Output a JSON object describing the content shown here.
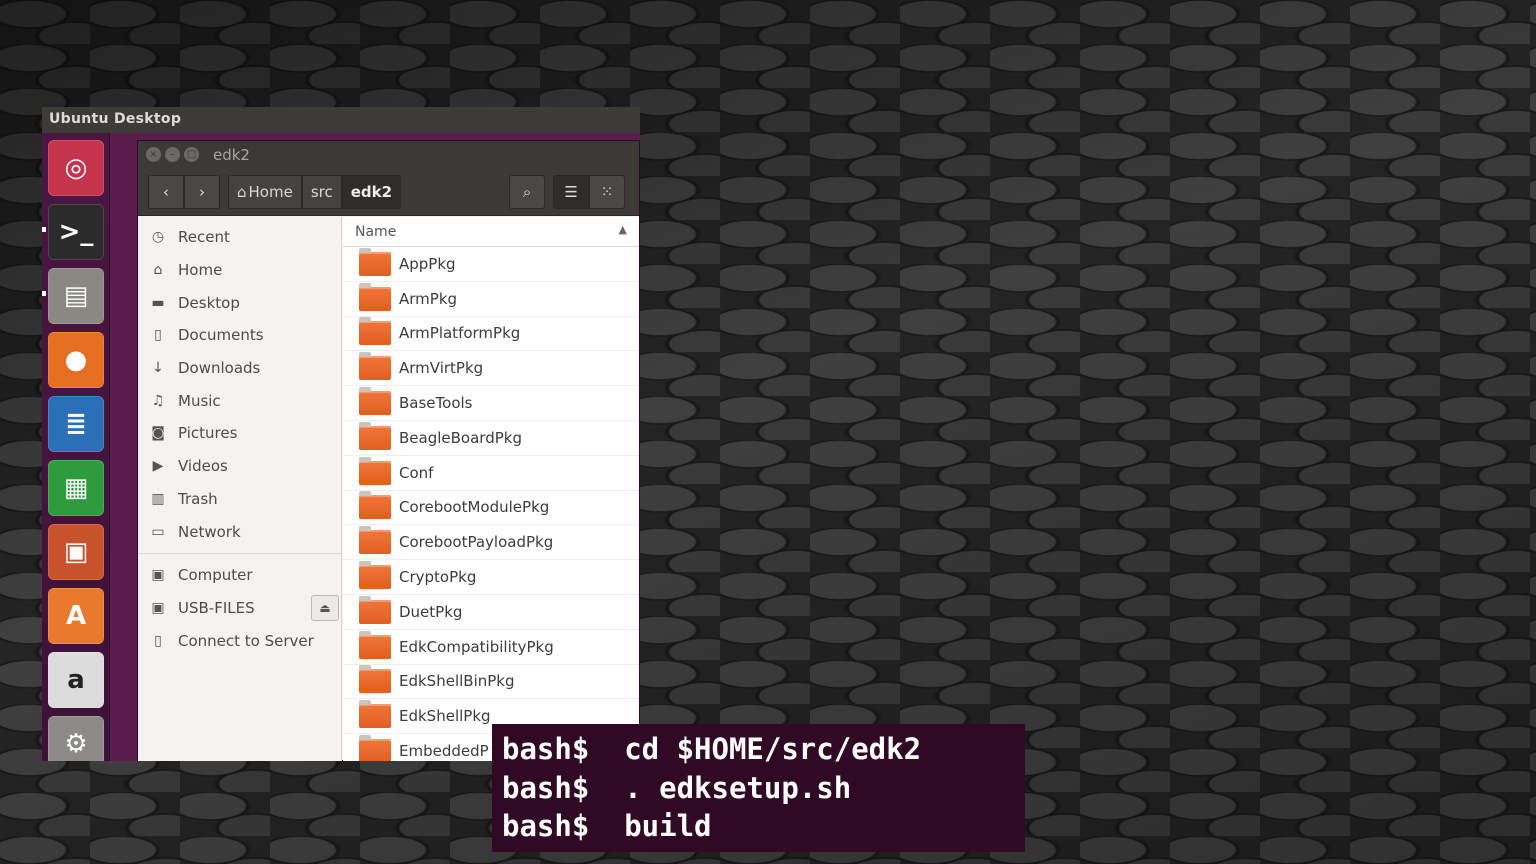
{
  "desktop": {
    "title": "Ubuntu Desktop"
  },
  "launcher": [
    {
      "icon": "ubuntu-dash-icon",
      "glyph": "◎",
      "bg": "#c5344c"
    },
    {
      "icon": "terminal-icon",
      "glyph": ">_",
      "bg": "#2b2b2b"
    },
    {
      "icon": "files-icon",
      "glyph": "▤",
      "bg": "#8a8882"
    },
    {
      "icon": "firefox-icon",
      "glyph": "●",
      "bg": "#e66e20"
    },
    {
      "icon": "writer-icon",
      "glyph": "≣",
      "bg": "#2a6fb8"
    },
    {
      "icon": "calc-icon",
      "glyph": "▦",
      "bg": "#2f9a3e"
    },
    {
      "icon": "impress-icon",
      "glyph": "▣",
      "bg": "#c8522c"
    },
    {
      "icon": "software-center-icon",
      "glyph": "A",
      "bg": "#e87a2e"
    },
    {
      "icon": "amazon-icon",
      "glyph": "a",
      "bg": "#dcdcdc"
    },
    {
      "icon": "system-settings-icon",
      "glyph": "⚙",
      "bg": "#8c8a86"
    }
  ],
  "window": {
    "title": "edk2",
    "breadcrumbs": [
      "Home",
      "src",
      "edk2"
    ]
  },
  "sidebar": {
    "places": [
      {
        "label": "Recent",
        "icon": "clock-icon",
        "glyph": "◷"
      },
      {
        "label": "Home",
        "icon": "home-icon",
        "glyph": "⌂"
      },
      {
        "label": "Desktop",
        "icon": "folder-icon",
        "glyph": "▬"
      },
      {
        "label": "Documents",
        "icon": "document-icon",
        "glyph": "▯"
      },
      {
        "label": "Downloads",
        "icon": "download-icon",
        "glyph": "↓"
      },
      {
        "label": "Music",
        "icon": "music-icon",
        "glyph": "♫"
      },
      {
        "label": "Pictures",
        "icon": "camera-icon",
        "glyph": "◙"
      },
      {
        "label": "Videos",
        "icon": "video-icon",
        "glyph": "▶"
      },
      {
        "label": "Trash",
        "icon": "trash-icon",
        "glyph": "▥"
      },
      {
        "label": "Network",
        "icon": "network-icon",
        "glyph": "▭"
      }
    ],
    "devices": [
      {
        "label": "Computer",
        "icon": "drive-icon",
        "glyph": "▣"
      },
      {
        "label": "USB-FILES",
        "icon": "usb-drive-icon",
        "glyph": "▣"
      },
      {
        "label": "Connect to Server",
        "icon": "server-icon",
        "glyph": "▯"
      }
    ]
  },
  "filelist": {
    "column": "Name",
    "files": [
      "AppPkg",
      "ArmPkg",
      "ArmPlatformPkg",
      "ArmVirtPkg",
      "BaseTools",
      "BeagleBoardPkg",
      "Conf",
      "CorebootModulePkg",
      "CorebootPayloadPkg",
      "CryptoPkg",
      "DuetPkg",
      "EdkCompatibilityPkg",
      "EdkShellBinPkg",
      "EdkShellPkg",
      "EmbeddedP"
    ]
  },
  "terminal": {
    "lines": [
      "bash$  cd $HOME/src/edk2",
      "bash$  . edksetup.sh",
      "bash$  build"
    ]
  }
}
